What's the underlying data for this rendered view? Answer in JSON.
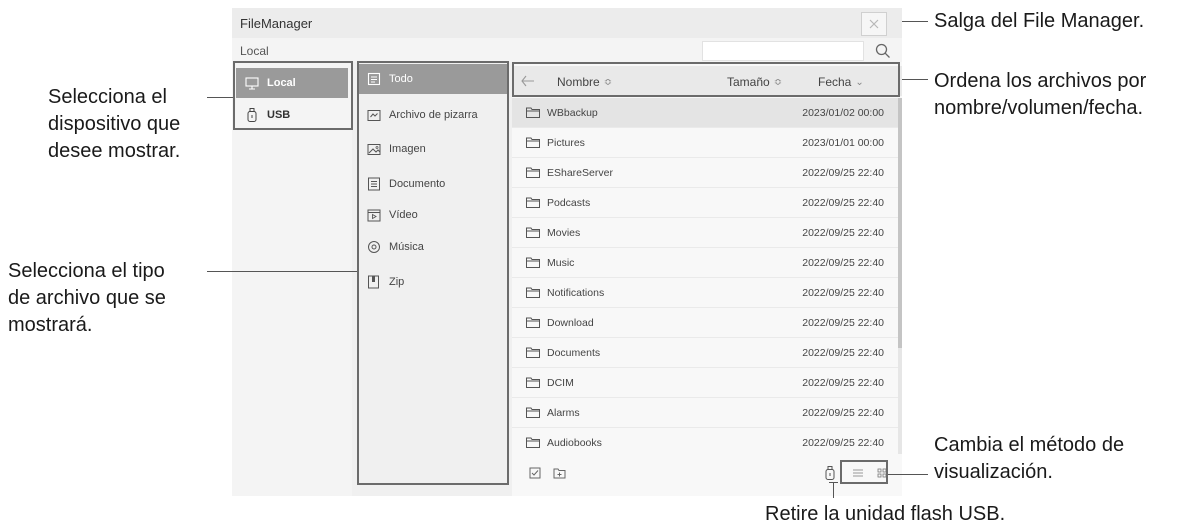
{
  "window": {
    "title": "FileManager",
    "path": "Local",
    "search_placeholder": ""
  },
  "devices": [
    {
      "label": "Local",
      "icon": "monitor-icon",
      "selected": true
    },
    {
      "label": "USB",
      "icon": "usb-icon",
      "selected": false
    }
  ],
  "types": [
    {
      "label": "Todo",
      "icon": "all-files-icon",
      "selected": true
    },
    {
      "label": "Archivo de pizarra",
      "icon": "whiteboard-file-icon",
      "selected": false
    },
    {
      "label": "Imagen",
      "icon": "image-icon",
      "selected": false
    },
    {
      "label": "Documento",
      "icon": "document-icon",
      "selected": false
    },
    {
      "label": "Vídeo",
      "icon": "video-icon",
      "selected": false
    },
    {
      "label": "Música",
      "icon": "music-icon",
      "selected": false
    },
    {
      "label": "Zip",
      "icon": "zip-icon",
      "selected": false
    }
  ],
  "sort": {
    "name": "Nombre",
    "size": "Tamaño",
    "date": "Fecha",
    "sort_glyph": "≎",
    "date_glyph": "⌄"
  },
  "files": [
    {
      "name": "WBbackup",
      "date": "2023/01/02 00:00"
    },
    {
      "name": "Pictures",
      "date": "2023/01/01 00:00"
    },
    {
      "name": "EShareServer",
      "date": "2022/09/25 22:40"
    },
    {
      "name": "Podcasts",
      "date": "2022/09/25 22:40"
    },
    {
      "name": "Movies",
      "date": "2022/09/25 22:40"
    },
    {
      "name": "Music",
      "date": "2022/09/25 22:40"
    },
    {
      "name": "Notifications",
      "date": "2022/09/25 22:40"
    },
    {
      "name": "Download",
      "date": "2022/09/25 22:40"
    },
    {
      "name": "Documents",
      "date": "2022/09/25 22:40"
    },
    {
      "name": "DCIM",
      "date": "2022/09/25 22:40"
    },
    {
      "name": "Alarms",
      "date": "2022/09/25 22:40"
    },
    {
      "name": "Audiobooks",
      "date": "2022/09/25 22:40"
    }
  ],
  "annotations": {
    "exit": "Salga del File Manager.",
    "sort_line1": "Ordena los archivos por",
    "sort_line2": "nombre/volumen/fecha.",
    "device_line1": "Selecciona el",
    "device_line2": "dispositivo que",
    "device_line3": "desee mostrar.",
    "type_line1": "Selecciona el tipo",
    "type_line2": "de archivo que se",
    "type_line3": "mostrará.",
    "view_line1": "Cambia el método de",
    "view_line2": "visualización.",
    "usb": "Retire la unidad flash USB."
  },
  "colors": {
    "selected_bg": "#9a9a9a",
    "window_bg": "#f0f0f0",
    "annotation_box": "#6b6b6b"
  }
}
